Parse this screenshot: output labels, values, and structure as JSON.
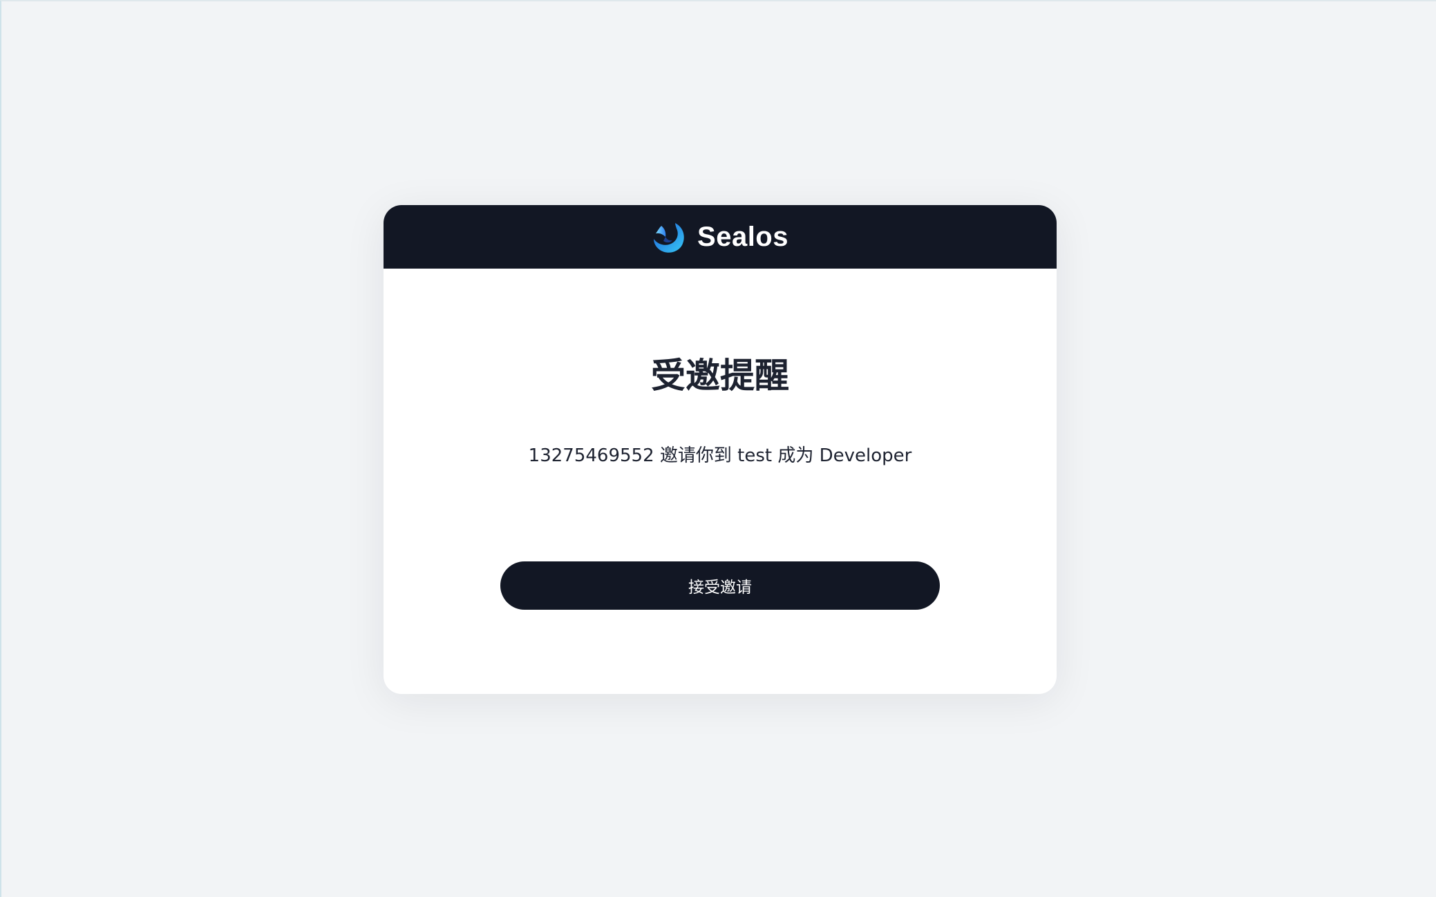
{
  "header": {
    "brand": "Sealos",
    "logo_icon": "sealos-logo-icon",
    "background_color": "#121724"
  },
  "invite": {
    "title": "受邀提醒",
    "message": "13275469552 邀请你到 test 成为 Developer",
    "accept_label": "接受邀请"
  },
  "colors": {
    "page_background": "#f2f4f6",
    "card_background": "#ffffff",
    "button_background": "#121724",
    "logo_gradient_start": "#2f7ff0",
    "logo_gradient_end": "#36c8f6"
  }
}
